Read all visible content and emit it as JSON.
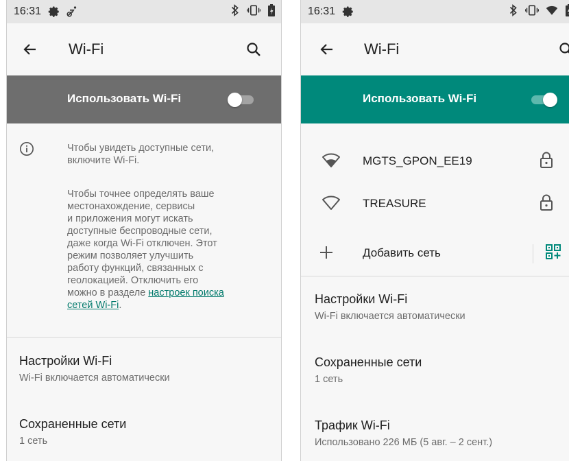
{
  "left": {
    "status": {
      "time": "16:31"
    },
    "app_bar": {
      "title": "Wi-Fi"
    },
    "master_switch": {
      "label": "Использовать Wi-Fi",
      "checked": false
    },
    "info": {
      "line1": "Чтобы увидеть доступные сети,",
      "line2": "включите Wi-Fi.",
      "scan_text_lines": [
        "Чтобы точнее определять ваше",
        "местонахождение, сервисы",
        "и приложения могут искать",
        "доступные беспроводные сети,",
        "даже когда Wi-Fi отключен. Этот",
        "режим позволяет улучшить",
        "работу функций, связанных с",
        "геолокацией. Отключить его",
        "можно в разделе "
      ],
      "link_part1": "настроек поиска",
      "link_part2": "сетей Wi-Fi",
      "link_suffix": "."
    },
    "prefs": [
      {
        "title": "Настройки Wi-Fi",
        "summary": "Wi-Fi включается автоматически"
      },
      {
        "title": "Сохраненные сети",
        "summary": "1 сеть"
      }
    ]
  },
  "right": {
    "status": {
      "time": "16:31"
    },
    "app_bar": {
      "title": "Wi-Fi"
    },
    "master_switch": {
      "label": "Использовать Wi-Fi",
      "checked": true
    },
    "networks": [
      {
        "ssid": "MGTS_GPON_EE19",
        "secured": true,
        "signal": "strong"
      },
      {
        "ssid": "TREASURE",
        "secured": true,
        "signal": "none"
      }
    ],
    "add_network": {
      "label": "Добавить сеть"
    },
    "prefs": [
      {
        "title": "Настройки Wi-Fi",
        "summary": "Wi-Fi включается автоматически"
      },
      {
        "title": "Сохраненные сети",
        "summary": "1 сеть"
      },
      {
        "title": "Трафик Wi-Fi",
        "summary": "Использовано 226 МБ (5 авг. – 2 сент.)"
      }
    ]
  },
  "colors": {
    "accent": "#00897b",
    "switch_bar_off": "#6e6e6e",
    "link": "#00796b"
  },
  "icons": [
    "gear-icon",
    "accessibility-icon",
    "bluetooth-icon",
    "vibrate-icon",
    "battery-icon",
    "wifi-signal-icon",
    "arrow-back-icon",
    "search-icon",
    "info-icon",
    "wifi-strong-icon",
    "wifi-empty-icon",
    "lock-icon",
    "plus-icon",
    "qr-code-icon"
  ]
}
